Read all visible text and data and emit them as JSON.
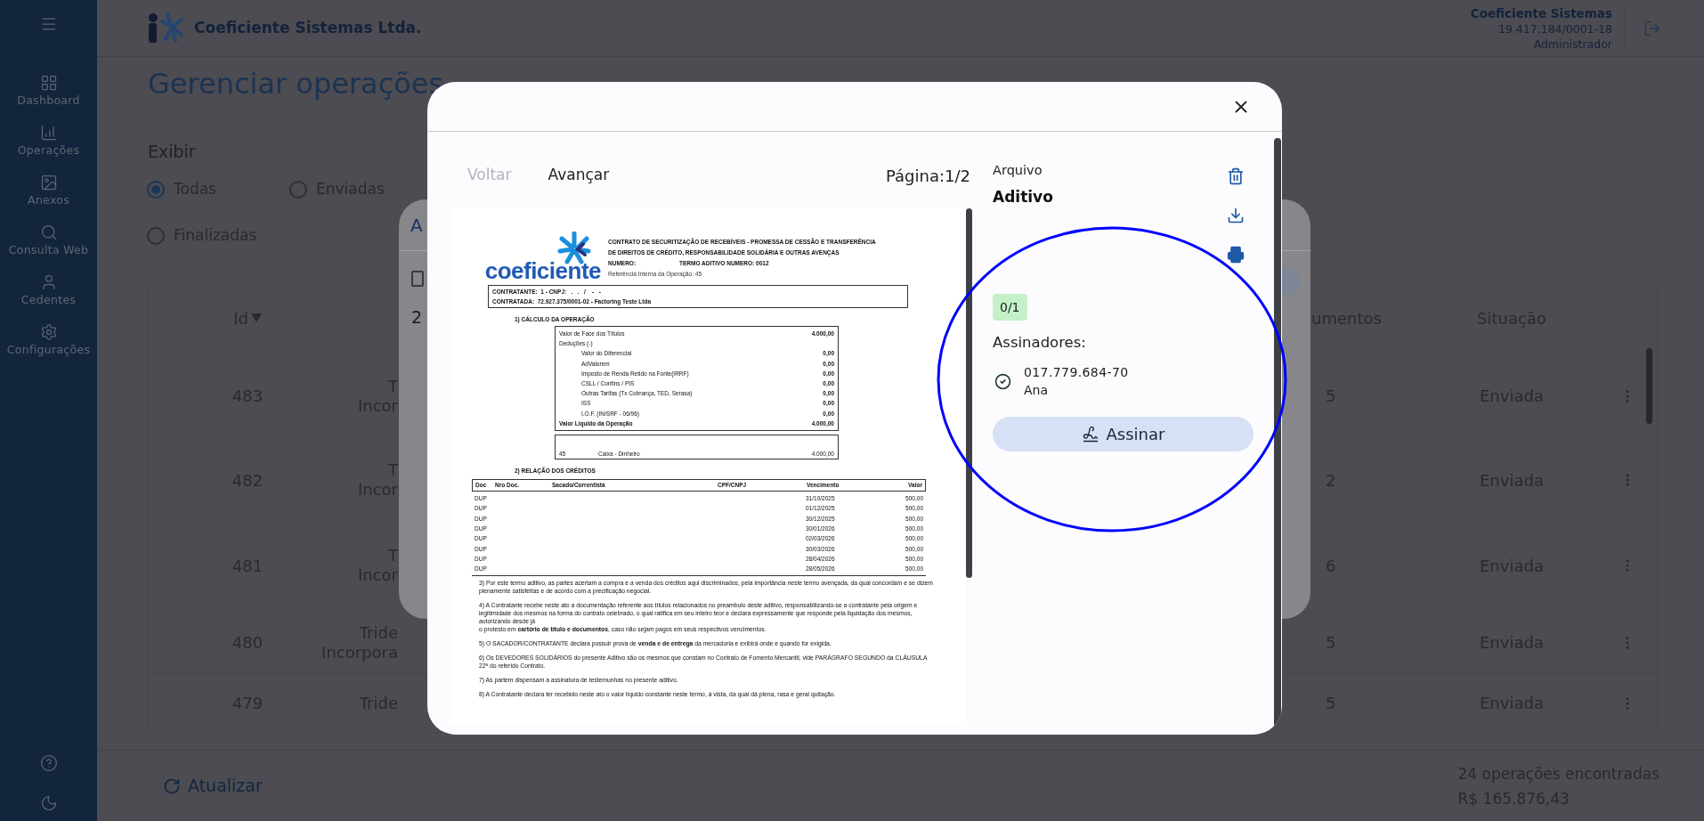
{
  "header": {
    "company": "Coeficiente Sistemas Ltda.",
    "user": {
      "name": "Coeficiente Sistemas",
      "cnpj": "19.417.184/0001-18",
      "role": "Administrador"
    }
  },
  "sidebar": {
    "items": [
      {
        "label": "Dashboard"
      },
      {
        "label": "Operações"
      },
      {
        "label": "Anexos"
      },
      {
        "label": "Consulta Web"
      },
      {
        "label": "Cedentes"
      },
      {
        "label": "Configurações"
      }
    ]
  },
  "page": {
    "title": "Gerenciar operações",
    "filter": {
      "label": "Exibir",
      "options": [
        {
          "label": "Todas",
          "selected": true
        },
        {
          "label": "Enviadas",
          "selected": false
        },
        {
          "label": "Finalizadas",
          "selected": false
        }
      ]
    }
  },
  "table": {
    "columns": [
      {
        "label": "Id",
        "sorted": true
      },
      {
        "label": "umentos",
        "sorted": false
      },
      {
        "label": "Situação",
        "sorted": false
      }
    ],
    "rows": [
      {
        "id": "483",
        "column_2": [
          "T",
          "Incor"
        ],
        "documents": "5",
        "status": "Enviada"
      },
      {
        "id": "482",
        "column_2": [
          "T",
          "Incor"
        ],
        "documents": "2",
        "status": "Enviada"
      },
      {
        "id": "481",
        "column_2": [
          "T",
          "Incor"
        ],
        "documents": "6",
        "status": "Enviada"
      },
      {
        "id": "480",
        "column_2": [
          "Tride",
          "Incorpora"
        ],
        "documents": "5",
        "status": "Enviada"
      },
      {
        "id": "479",
        "column_2": [
          "Tride"
        ],
        "documents": "5",
        "status": "Enviada"
      }
    ]
  },
  "footer": {
    "refresh": "Atualizar",
    "count": "24 operações encontradas",
    "total": "R$ 165.876,43"
  },
  "back_dialog": {
    "tab": "A",
    "count": "2"
  },
  "modal": {
    "nav": {
      "back": {
        "label": "Voltar",
        "disabled": true
      },
      "next": {
        "label": "Avançar",
        "disabled": false
      },
      "page": "Página:1/2"
    },
    "file": {
      "label": "Arquivo",
      "name": "Aditivo"
    },
    "signature_count": "0/1",
    "signers_label": "Assinadores:",
    "signers": [
      {
        "document": "017.779.684-70",
        "name": "Ana"
      }
    ],
    "sign_button": "Assinar",
    "document": {
      "logo": "coeficiente",
      "title_lines": [
        "CONTRATO DE SECURITIZAÇÃO DE RECEBÍVEIS - PROMESSA DE CESSÃO E TRANSFERÊNCIA",
        "DE DIREITOS DE CRÉDITO, RESPONSABILIDADE SOLIDÁRIA E OUTRAS AVENÇAS"
      ],
      "number_label": "NUMERO:",
      "term": "TERMO ADITIVO NUMERO: 0012",
      "reference": "Referência Interna da Operação: 45",
      "parties": [
        "CONTRATANTE:  1 - CNPJ:   .   .   /    -   -",
        "CONTRATADA:  72.927.375/0001-02 - Factoring Teste Ltda"
      ],
      "section_1": "1) CÁLCULO DA OPERAÇÃO",
      "calc_rows": [
        {
          "kind": "face",
          "label": "Valor de Face dos Títulos",
          "value": "4.000,00"
        },
        {
          "kind": "group",
          "label": "Deduções (-)"
        },
        {
          "kind": "item",
          "label": "Valor do Diferencial",
          "value": "0,00"
        },
        {
          "kind": "item",
          "label": "AdValorem",
          "value": "0,00"
        },
        {
          "kind": "item",
          "label": "Imposto de Renda Retido na Fonte(IRRF)",
          "value": "0,00"
        },
        {
          "kind": "item",
          "label": "CSLL / Confins / PIS",
          "value": "0,00"
        },
        {
          "kind": "item",
          "label": "Outras Tarifas (Tx Cobrança, TED, Serasa)",
          "value": "0,00"
        },
        {
          "kind": "item",
          "label": "ISS",
          "value": "0,00"
        },
        {
          "kind": "item",
          "label": "I.O.F. (IN/SRF - 06/96)",
          "value": "0,00"
        },
        {
          "kind": "total",
          "label": "Valor Liquido da Operação",
          "value": "4.000,00"
        }
      ],
      "payment": {
        "code": "45",
        "label": "Caixa - Dinheiro",
        "value": "4.000,00"
      },
      "section_2": "2) RELAÇÃO DOS CRÉDITOS",
      "credit_columns": [
        "Doc",
        "Nro Doc.",
        "Sacado/Correntista",
        "CPF/CNPJ",
        "Vencimento",
        "Valor"
      ],
      "credits": [
        {
          "doc": "DUP",
          "due": "31/10/2025",
          "value": "500,00"
        },
        {
          "doc": "DUP",
          "due": "01/12/2025",
          "value": "500,00"
        },
        {
          "doc": "DUP",
          "due": "30/12/2025",
          "value": "500,00"
        },
        {
          "doc": "DUP",
          "due": "30/01/2026",
          "value": "500,00"
        },
        {
          "doc": "DUP",
          "due": "02/03/2026",
          "value": "500,00"
        },
        {
          "doc": "DUP",
          "due": "30/03/2026",
          "value": "500,00"
        },
        {
          "doc": "DUP",
          "due": "28/04/2026",
          "value": "500,00"
        },
        {
          "doc": "DUP",
          "due": "28/05/2026",
          "value": "500,00"
        }
      ],
      "clauses": [
        "3) Por este termo aditivo, as partes acertam a compra e a venda dos créditos aqui discriminados, pela importância neste termo avençada, da qual concordam e se dizem plenamente satisfeitas e de acordo com a precificação negocial.",
        "4) A Contratante recebe neste ato a documentação referente aos títulos relacionados no preambulo deste aditivo, responsabilizando-se a contratante pela origem e legitimidade dos mesmos na forma do contrato celebrado, o qual ratifica em seu inteiro teor e declara expressamente que responde pela liquidação dos mesmos, autorizando desde já\no protesto em **cartório de título e documentos**, caso não sejam pagos em seus respectivos vencimentos.",
        "5) O SACADOR/CONTRATANTE declara possuir prova de **venda e de entrega** da mercadoria e exibirá onde e quando for exigida.",
        "6) Os DEVEDORES SOLIDÁRIOS do presente Aditivo são os mesmos que constam no Contrato de Fomento Mercantil, vide PARÁGRAFO SEGUNDO da CLÁUSULA 22ª do referido Contrato.",
        "7) As partem dispensam a assinatura de testemunhas no presente aditivo.",
        "8) A Contratante declara ter recebido neste ato o valor liquido constante neste termo, à vista, da qual dá plena, rasa e geral quitação."
      ]
    }
  }
}
